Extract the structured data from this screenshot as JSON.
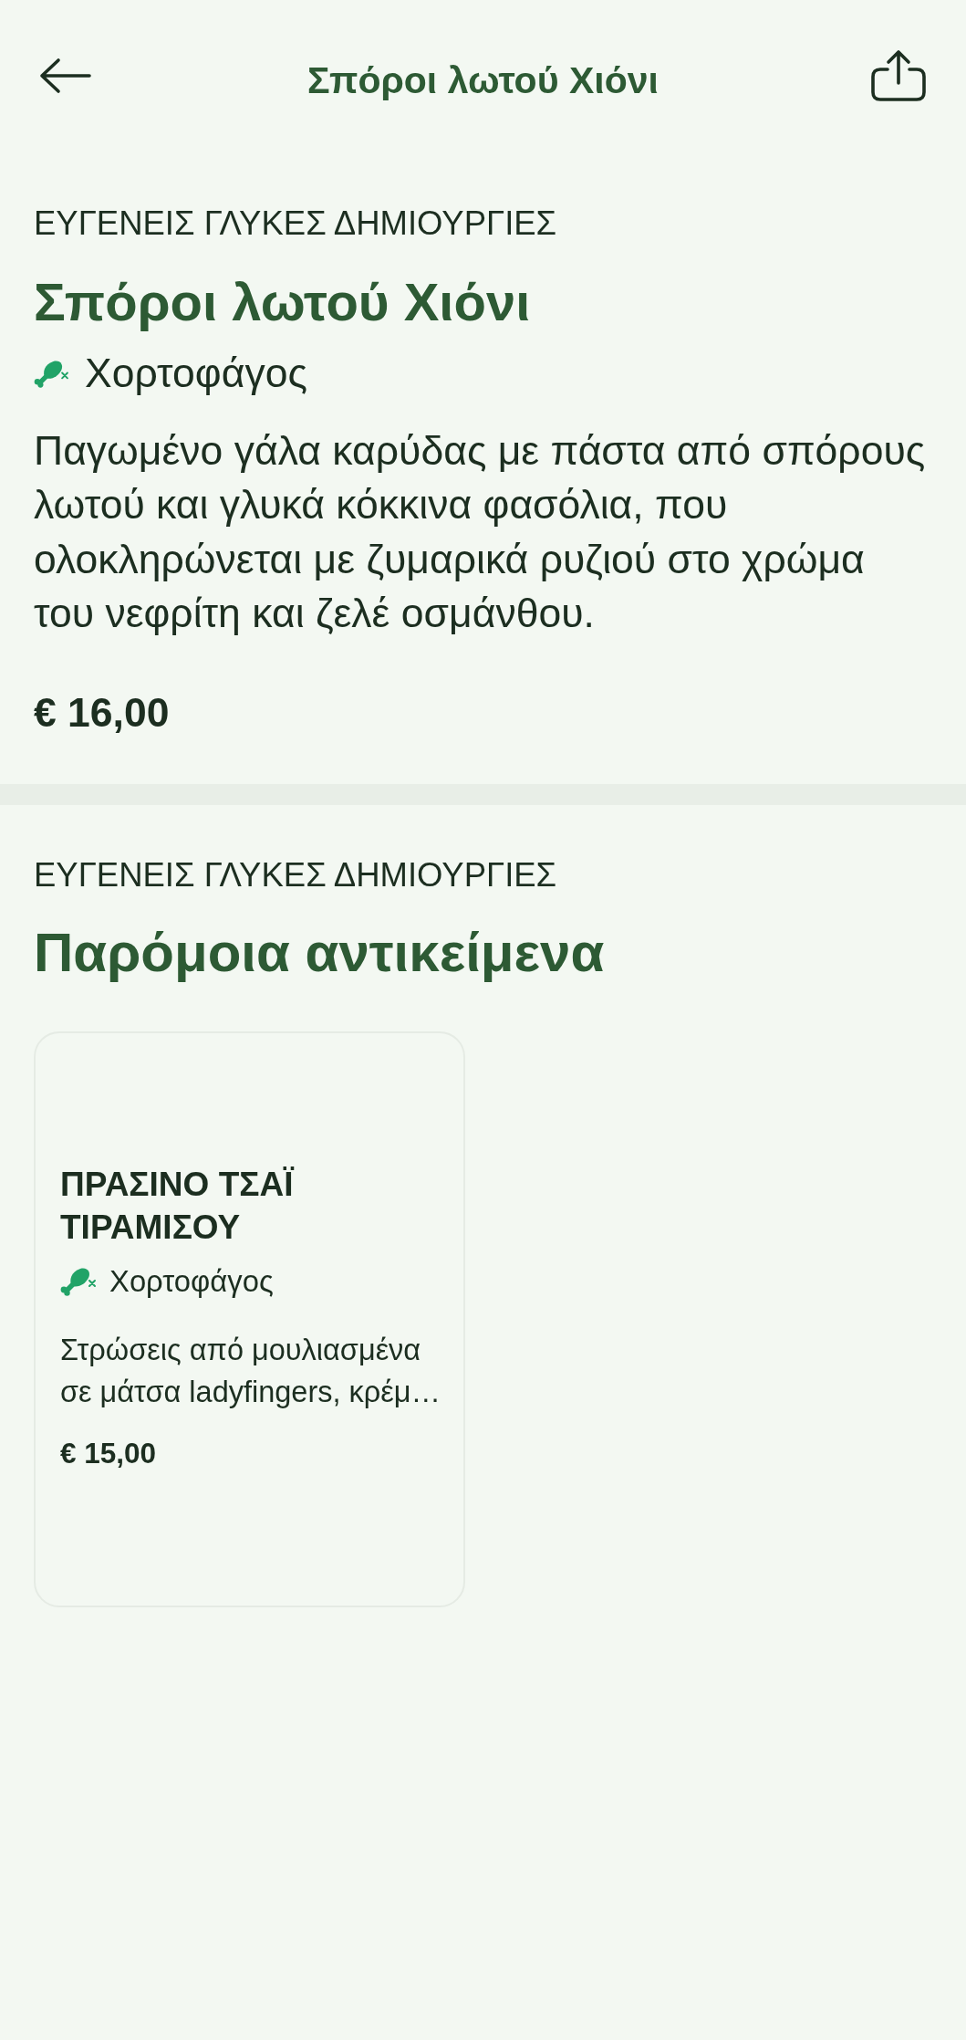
{
  "header": {
    "title": "Σπόροι λωτού Χιόνι"
  },
  "product": {
    "category": "ΕΥΓΕΝΕΙΣ ΓΛΥΚΕΣ ΔΗΜΙΟΥΡΓΙΕΣ",
    "name": "Σπόροι λωτού Χιόνι",
    "diet": "Χορτοφάγος",
    "description": "Παγωμένο γάλα καρύδας με πάστα από σπόρους λωτού και γλυκά κόκκινα φασόλια, που ολοκληρώνεται με ζυμαρικά ρυζιού στο χρώμα του νεφρίτη και ζελέ οσμάνθου.",
    "price": "€ 16,00"
  },
  "similar": {
    "category": "ΕΥΓΕΝΕΙΣ ΓΛΥΚΕΣ ΔΗΜΙΟΥΡΓΙΕΣ",
    "title": "Παρόμοια αντικείμενα",
    "items": [
      {
        "name": "ΠΡΑΣΙΝΟ ΤΣΑΪ ΤΙΡΑΜΙΣΟΥ",
        "diet": "Χορτοφάγος",
        "description": "Στρώσεις από μουλιασμένα σε μάτσα ladyfingers, κρέμ…",
        "price": "€ 15,00"
      }
    ]
  }
}
